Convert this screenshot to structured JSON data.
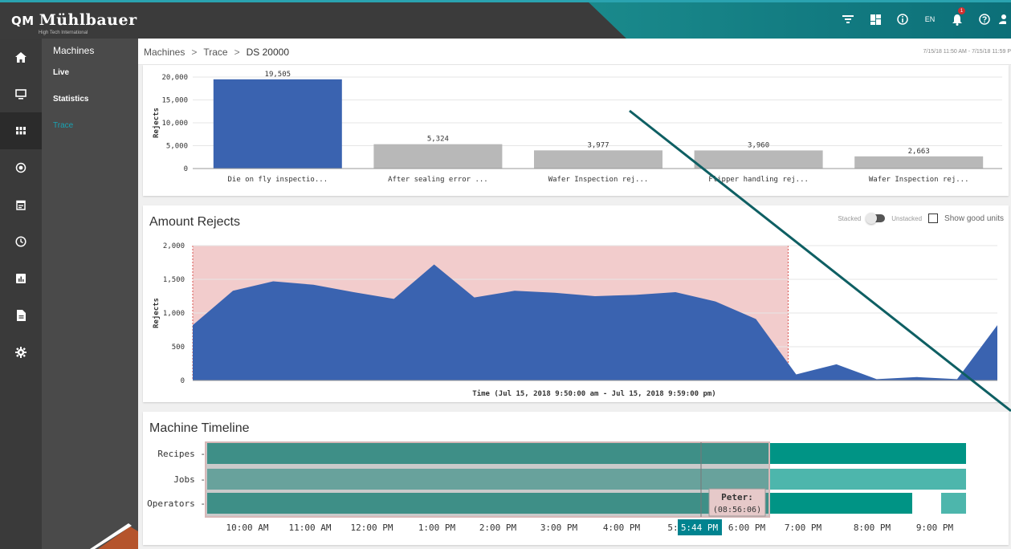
{
  "header": {
    "brand": "Mühlbauer",
    "brand_mark": "QM",
    "tagline": "High Tech International",
    "language": "EN",
    "notification_count": "1",
    "colors": {
      "bar": "#3b3b3b",
      "accent": "#0e8c8c"
    }
  },
  "rail": {
    "icons": [
      "home-icon",
      "monitor-icon",
      "grid-icon",
      "target-icon",
      "calendar-icon",
      "clock-icon",
      "bar-chart-icon",
      "document-icon",
      "gear-icon"
    ]
  },
  "subnav": {
    "title": "Machines",
    "items": [
      {
        "label": "Live"
      },
      {
        "label": "Statistics"
      },
      {
        "label": "Trace",
        "active": true
      }
    ]
  },
  "breadcrumb": {
    "items": [
      "Machines",
      "Trace",
      "DS 20000"
    ],
    "date_range": "7/15/18 11:50 AM - 7/15/18 11:59 P"
  },
  "rejects_chart": {
    "chart_data": {
      "type": "bar",
      "ylabel": "Rejects",
      "ylim": [
        0,
        20000
      ],
      "yticks": [
        "0",
        "5,000",
        "10,000",
        "15,000",
        "20,000"
      ],
      "categories": [
        "Die on fly inspectio...",
        "After sealing error ...",
        "Wafer Inspection rej...",
        "Flipper handling rej...",
        "Wafer Inspection rej..."
      ],
      "values": [
        19505,
        5324,
        3977,
        3960,
        2663
      ],
      "value_labels": [
        "19,505",
        "5,324",
        "3,977",
        "3,960",
        "2,663"
      ],
      "colors": [
        "#3a63b0",
        "#b8b8b8",
        "#b8b8b8",
        "#b8b8b8",
        "#b8b8b8"
      ]
    }
  },
  "amount_rejects": {
    "title": "Amount Rejects",
    "stacked_label": "Stacked",
    "unstacked_label": "Unstacked",
    "show_good_label": "Show good units",
    "chart_data": {
      "type": "area",
      "ylabel": "Rejects",
      "xlabel": "Time (Jul 15, 2018 9:50:00 am - Jul 15, 2018 9:59:00 pm)",
      "ylim": [
        0,
        2000
      ],
      "yticks": [
        "0",
        "500",
        "1,000",
        "1,500",
        "2,000"
      ],
      "values": [
        820,
        1330,
        1470,
        1420,
        1310,
        1210,
        1720,
        1230,
        1330,
        1300,
        1250,
        1270,
        1310,
        1170,
        910,
        90,
        240,
        20,
        50,
        20,
        820
      ],
      "highlight_range_index": [
        0,
        14.8
      ],
      "color": "#3a63b0",
      "highlight_color": "#f2cccc"
    }
  },
  "timeline": {
    "title": "Machine Timeline",
    "rows": [
      "Recipes",
      "Jobs",
      "Operators"
    ],
    "time_labels": [
      "10:00 AM",
      "11:00 AM",
      "12:00 PM",
      "1:00 PM",
      "2:00 PM",
      "3:00 PM",
      "4:00 PM",
      "5:",
      "6:00 PM",
      "7:00 PM",
      "8:00 PM",
      "9:00 PM"
    ],
    "cursor_time": "5:44 PM",
    "tooltip_name": "Peter:",
    "tooltip_time": "(08:56:06)",
    "colors": {
      "recipes": "#009485",
      "jobs": "#4db6ac",
      "operators": "#009485",
      "selection": "#8a8a8a"
    }
  }
}
